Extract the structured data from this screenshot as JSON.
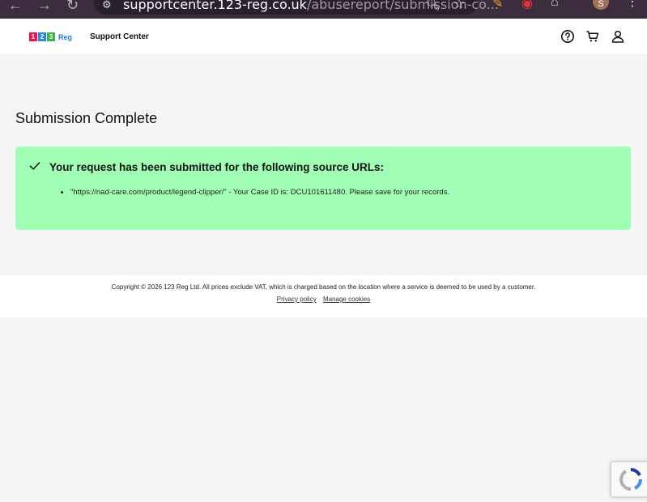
{
  "browser": {
    "url_host": "supportcenter.123-reg.co.uk",
    "url_path": "/abusereport/submission-co...",
    "avatar_initial": "S"
  },
  "header": {
    "logo_digits": [
      "1",
      "2",
      "3"
    ],
    "logo_digit_colors": [
      "#e8174a",
      "#2a8cd6",
      "#3fb34f"
    ],
    "logo_word": "Reg",
    "section_title": "Support Center",
    "icons": [
      "help-icon",
      "cart-icon",
      "account-icon"
    ]
  },
  "main": {
    "page_title": "Submission Complete",
    "alert": {
      "title": "Your request has been submitted for the following source URLs:",
      "items": [
        "\"https://nad-care.com/product/legend-clipper/\" - Your Case ID is: DCU101611480. Please save for your records."
      ],
      "background_color": "#a0ffb5"
    }
  },
  "footer": {
    "copyright": "Copyright © 2026 123 Reg Ltd. All prices exclude VAT, which is charged based on the location where a service is deemed to be used by a customer.",
    "links": [
      "Privacy policy",
      "Manage cookies"
    ]
  }
}
